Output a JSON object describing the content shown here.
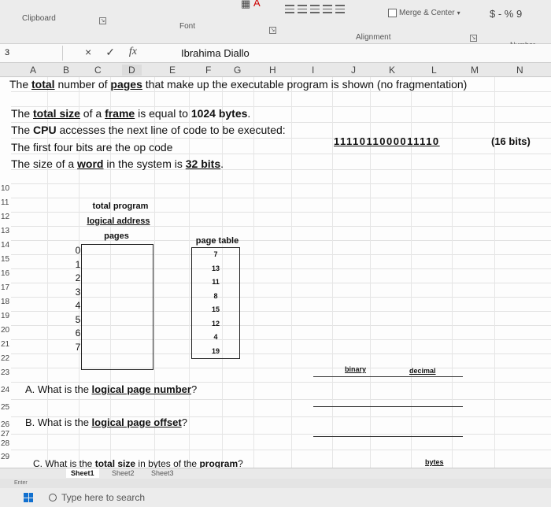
{
  "ribbon": {
    "clipboard_label": "Clipboard",
    "font_label": "Font",
    "alignment_label": "Alignment",
    "number_label": "Number",
    "merge_center_label": "Merge & Center",
    "currency_label": "$ - % 9"
  },
  "formula_bar": {
    "namebox": "3",
    "cancel_icon": "×",
    "enter_icon": "✓",
    "fx_icon": "fx",
    "content": "Ibrahima Diallo"
  },
  "columns": [
    "A",
    "B",
    "C",
    "D",
    "E",
    "F",
    "G",
    "H",
    "I",
    "J",
    "K",
    "L",
    "M",
    "N"
  ],
  "rows": [
    "10",
    "11",
    "12",
    "13",
    "14",
    "15",
    "16",
    "17",
    "18",
    "19",
    "20",
    "21",
    "22",
    "23",
    "24",
    "25",
    "26",
    "27",
    "28",
    "29"
  ],
  "lines": {
    "l1_a": "The ",
    "l1_b": "total",
    "l1_c": " number of ",
    "l1_d": "pages",
    "l1_e": " that make up the executable program is shown (no fragmentation)",
    "l2_a": "The ",
    "l2_b": "total size",
    "l2_c": " of a ",
    "l2_d": "frame",
    "l2_e": " is equal to ",
    "l2_f": "1024 bytes",
    "l2_g": ".",
    "l3_a": "The ",
    "l3_b": "CPU",
    "l3_c": " accesses the next line of code to be executed:",
    "l4": "The first four bits are the op code",
    "l5_a": "The size of a ",
    "l5_b": "word",
    "l5_c": " in the system is ",
    "l5_d": "32 bits",
    "l5_e": "."
  },
  "binary_value": "1111011000011110",
  "binary_unit": "(16 bits)",
  "program": {
    "header_1": "total program",
    "header_2": "logical address",
    "header_3": "pages",
    "page_numbers": [
      "0",
      "1",
      "2",
      "3",
      "4",
      "5",
      "6",
      "7"
    ]
  },
  "page_table": {
    "header": "page table",
    "entries": [
      "7",
      "13",
      "11",
      "8",
      "15",
      "12",
      "4",
      "19"
    ]
  },
  "answer_headers": {
    "binary": "binary",
    "decimal": "decimal",
    "bytes": "bytes"
  },
  "questions": {
    "a_prefix": "A. What is the ",
    "a_bold": "logical page number",
    "a_suffix": "?",
    "b_prefix": "B. What is the ",
    "b_bold": "logical page offset",
    "b_suffix": "?",
    "c_prefix": "C. What is the ",
    "c_bold": "total size",
    "c_mid": " in bytes of the ",
    "c_bold2": "program",
    "c_suffix": "?"
  },
  "sheet_tabs": [
    "Sheet1",
    "Sheet2",
    "Sheet3"
  ],
  "status": "Enter",
  "taskbar": {
    "search_placeholder": "Type here to search"
  }
}
